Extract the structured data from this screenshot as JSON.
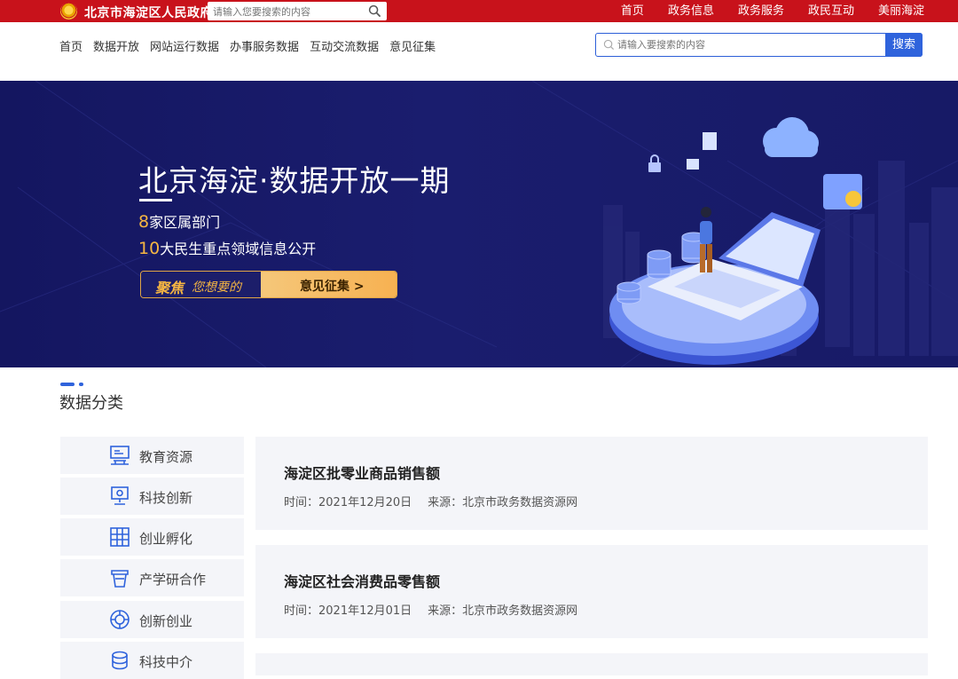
{
  "topbar": {
    "site_name": "北京市海淀区人民政府",
    "search_placeholder": "请输入您要搜索的内容",
    "nav": [
      "首页",
      "政务信息",
      "政务服务",
      "政民互动",
      "美丽海淀"
    ],
    "bg_color": "#c8121b"
  },
  "subnav": {
    "items": [
      "首页",
      "数据开放",
      "网站运行数据",
      "办事服务数据",
      "互动交流数据",
      "意见征集"
    ],
    "search_placeholder": "请输入要搜索的内容",
    "search_button": "搜索",
    "accent_color": "#2f63dc"
  },
  "banner": {
    "title": "北京海淀·数据开放一期",
    "stat1_num": "8",
    "stat1_text": "家区属部门",
    "stat2_num": "10",
    "stat2_text": "大民生重点领域信息公开",
    "pill_focus": "聚焦",
    "pill_want": "您想要的",
    "pill_cta": "意见征集 >"
  },
  "section": {
    "title": "数据分类"
  },
  "categories": [
    {
      "label": "教育资源",
      "icon": "education-icon"
    },
    {
      "label": "科技创新",
      "icon": "tech-innovation-icon"
    },
    {
      "label": "创业孵化",
      "icon": "incubation-icon"
    },
    {
      "label": "产学研合作",
      "icon": "cooperation-icon"
    },
    {
      "label": "创新创业",
      "icon": "innovation-icon"
    },
    {
      "label": "科技中介",
      "icon": "tech-agency-icon"
    }
  ],
  "datasets": [
    {
      "title": "海淀区批零业商品销售额",
      "time": "时间：2021年12月20日",
      "source": "来源：北京市政务数据资源网"
    },
    {
      "title": "海淀区社会消费品零售额",
      "time": "时间：2021年12月01日",
      "source": "来源：北京市政务数据资源网"
    }
  ]
}
